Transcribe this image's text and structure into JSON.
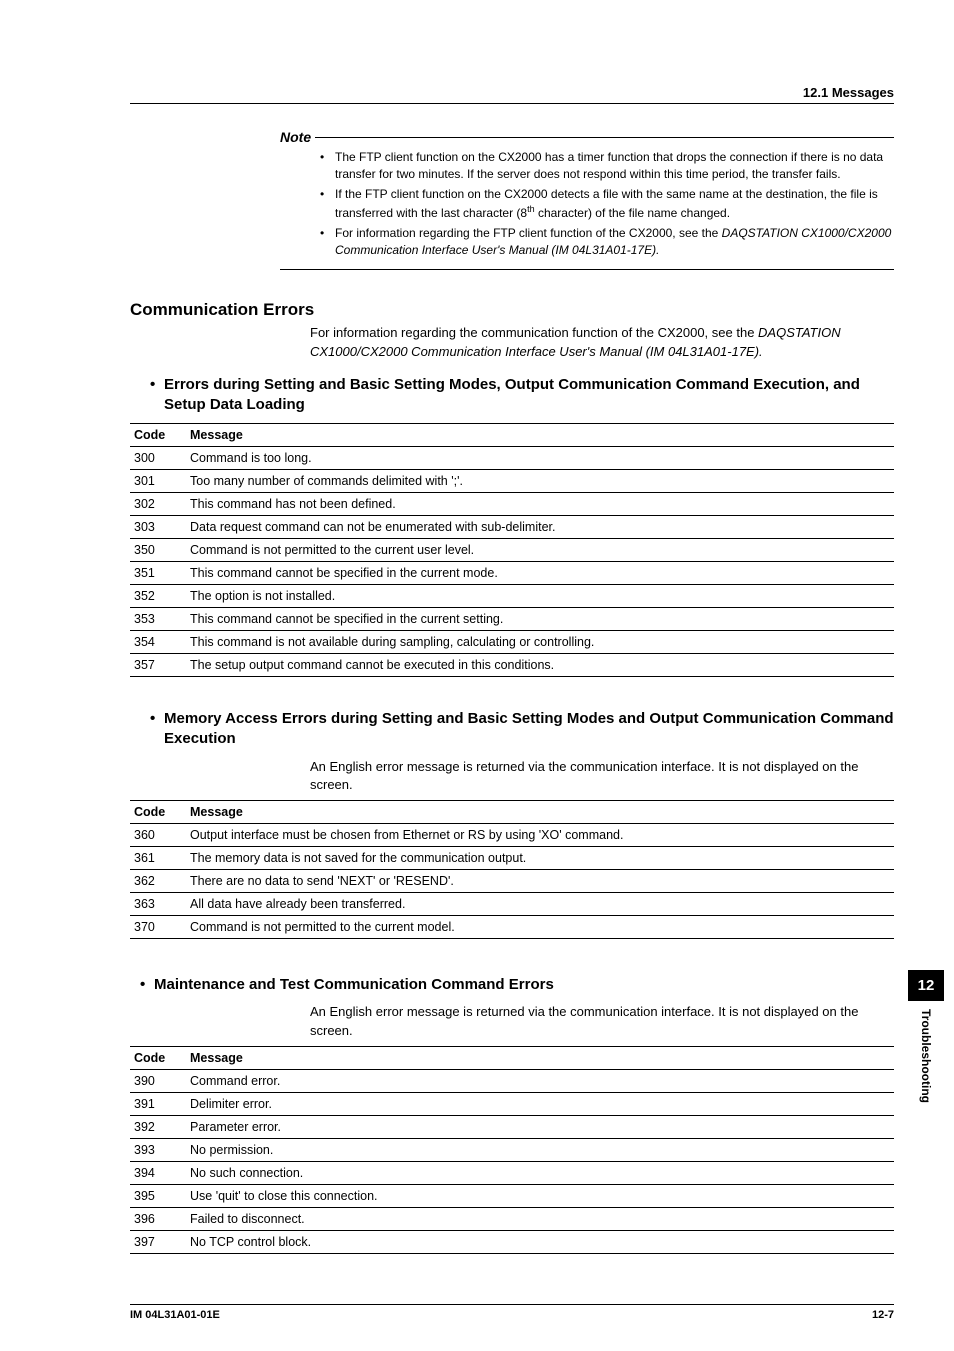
{
  "header": {
    "section_label": "12.1  Messages"
  },
  "note": {
    "title": "Note",
    "items": [
      "The FTP client function on the CX2000 has a timer function that drops the connection if there is no data transfer for two minutes.  If the server does not respond within this time period, the transfer fails.",
      "If the FTP client function on the CX2000 detects a file with the same name at the destination, the file is transferred with the last character (8th character) of the file name changed.",
      "For information regarding the FTP client function of the CX2000, see the DAQSTATION CX1000/CX2000 Communication Interface User's Manual (IM 04L31A01-17E)."
    ]
  },
  "comm_errors": {
    "title": "Communication Errors",
    "intro_plain": "For information regarding the communication function of the CX2000, see the ",
    "intro_italic": "DAQSTATION CX1000/CX2000 Communication Interface User's Manual (IM 04L31A01-17E)."
  },
  "table_headers": {
    "code": "Code",
    "message": "Message"
  },
  "section1": {
    "title": "Errors during Setting and Basic Setting Modes, Output Communication Command Execution, and Setup Data Loading",
    "rows": [
      {
        "code": "300",
        "msg": "Command is too long."
      },
      {
        "code": "301",
        "msg": "Too many number of commands delimited with ';'."
      },
      {
        "code": "302",
        "msg": "This command has not been defined."
      },
      {
        "code": "303",
        "msg": "Data request command can not be enumerated with sub-delimiter."
      },
      {
        "code": "350",
        "msg": "Command is not permitted to the current user level."
      },
      {
        "code": "351",
        "msg": "This command cannot be specified in the current mode."
      },
      {
        "code": "352",
        "msg": "The option is not installed."
      },
      {
        "code": "353",
        "msg": "This command cannot be specified in the current setting."
      },
      {
        "code": "354",
        "msg": "This command is not available during sampling, calculating or controlling."
      },
      {
        "code": "357",
        "msg": "The setup output command cannot be executed in this conditions."
      }
    ]
  },
  "section2": {
    "title": "Memory Access Errors during Setting and Basic Setting Modes and Output Communication Command Execution",
    "intro": "An English error message is returned via the communication interface.  It is not displayed on the screen.",
    "rows": [
      {
        "code": "360",
        "msg": "Output interface must be chosen from Ethernet or RS by using 'XO' command."
      },
      {
        "code": "361",
        "msg": "The memory data is not saved for the communication output."
      },
      {
        "code": "362",
        "msg": "There are no data to send 'NEXT' or 'RESEND'."
      },
      {
        "code": "363",
        "msg": "All data have already been transferred."
      },
      {
        "code": "370",
        "msg": "Command is not permitted to the current model."
      }
    ]
  },
  "section3": {
    "title": "Maintenance and Test Communication Command Errors",
    "intro": "An English error message is returned via the communication interface.  It is not displayed on the screen.",
    "rows": [
      {
        "code": "390",
        "msg": "Command error."
      },
      {
        "code": "391",
        "msg": "Delimiter error."
      },
      {
        "code": "392",
        "msg": "Parameter error."
      },
      {
        "code": "393",
        "msg": "No permission."
      },
      {
        "code": "394",
        "msg": "No such connection."
      },
      {
        "code": "395",
        "msg": "Use 'quit' to close this connection."
      },
      {
        "code": "396",
        "msg": "Failed to disconnect."
      },
      {
        "code": "397",
        "msg": "No TCP control block."
      }
    ]
  },
  "side_tab": {
    "number": "12",
    "label": "Troubleshooting"
  },
  "footer": {
    "left": "IM 04L31A01-01E",
    "right": "12-7"
  }
}
